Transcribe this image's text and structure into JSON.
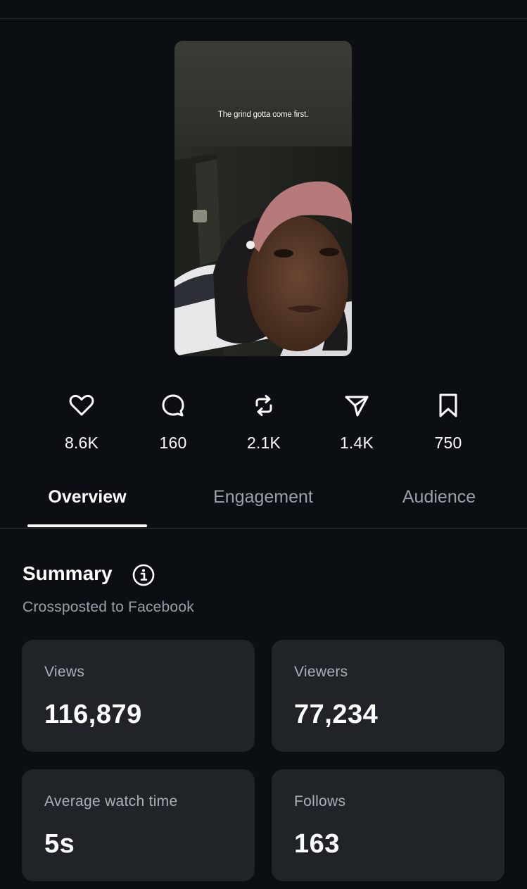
{
  "video": {
    "caption": "The grind gotta come first."
  },
  "stats": [
    {
      "icon": "heart-icon",
      "count": "8.6K"
    },
    {
      "icon": "comment-icon",
      "count": "160"
    },
    {
      "icon": "repost-icon",
      "count": "2.1K"
    },
    {
      "icon": "share-icon",
      "count": "1.4K"
    },
    {
      "icon": "bookmark-icon",
      "count": "750"
    }
  ],
  "tabs": [
    {
      "label": "Overview",
      "active": true
    },
    {
      "label": "Engagement",
      "active": false
    },
    {
      "label": "Audience",
      "active": false
    }
  ],
  "summary": {
    "title": "Summary",
    "subtitle": "Crossposted to Facebook",
    "cards": [
      {
        "label": "Views",
        "value": "116,879"
      },
      {
        "label": "Viewers",
        "value": "77,234"
      },
      {
        "label": "Average watch time",
        "value": "5s"
      },
      {
        "label": "Follows",
        "value": "163"
      }
    ]
  },
  "colors": {
    "background": "#0b0f14",
    "card": "#202429",
    "muted_text": "#9aa0a8",
    "active_tab": "#ffffff"
  }
}
